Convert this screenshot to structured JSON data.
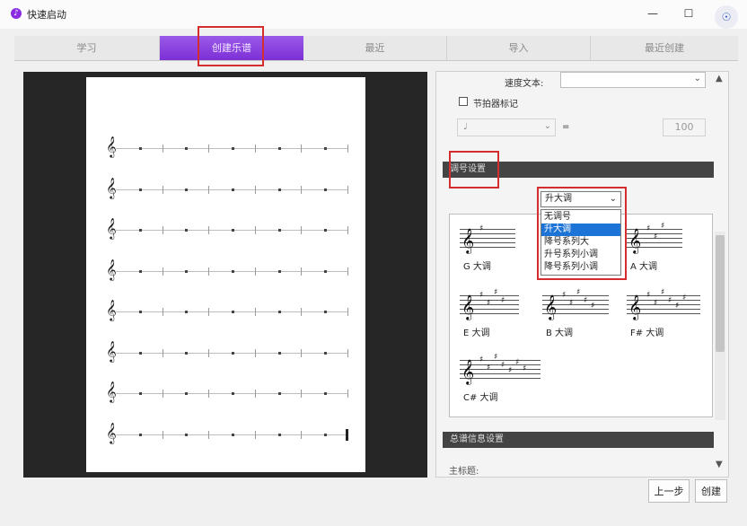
{
  "window": {
    "title": "快速启动",
    "minimize_glyph": "—",
    "maximize_glyph": "☐",
    "close_glyph": "✕",
    "extension_glyph": "☉"
  },
  "tabs": [
    {
      "label": "学习",
      "active": false
    },
    {
      "label": "创建乐谱",
      "active": true
    },
    {
      "label": "最近",
      "active": false
    },
    {
      "label": "导入",
      "active": false
    },
    {
      "label": "最近创建",
      "active": false
    }
  ],
  "preview": {
    "staff_rows": 8,
    "measures_per_row": 5,
    "clef_glyph": "𝄞"
  },
  "settings": {
    "tempo_text_label": "速度文本:",
    "tempo_text_value": "",
    "metronome_label": "节拍器标记",
    "metronome_note_value": "♩",
    "metronome_equals": "=",
    "metronome_bpm": "100",
    "key_section_title": "调号设置",
    "score_info_section_title": "总谱信息设置",
    "main_title_label": "主标题:"
  },
  "key_dropdown": {
    "selected": "升大调",
    "options": [
      "无调号",
      "升大调",
      "降号系列大",
      "升号系列小调",
      "降号系列小调"
    ],
    "highlighted_index": 1
  },
  "key_signatures": [
    {
      "name": "G 大调",
      "sharps": 1
    },
    {
      "name": "A 大调",
      "sharps": 3
    },
    {
      "name": "E 大调",
      "sharps": 4
    },
    {
      "name": "B 大调",
      "sharps": 5
    },
    {
      "name": "F# 大调",
      "sharps": 6
    },
    {
      "name": "C# 大调",
      "sharps": 7
    }
  ],
  "buttons": {
    "back": "上一步",
    "create": "创建"
  }
}
